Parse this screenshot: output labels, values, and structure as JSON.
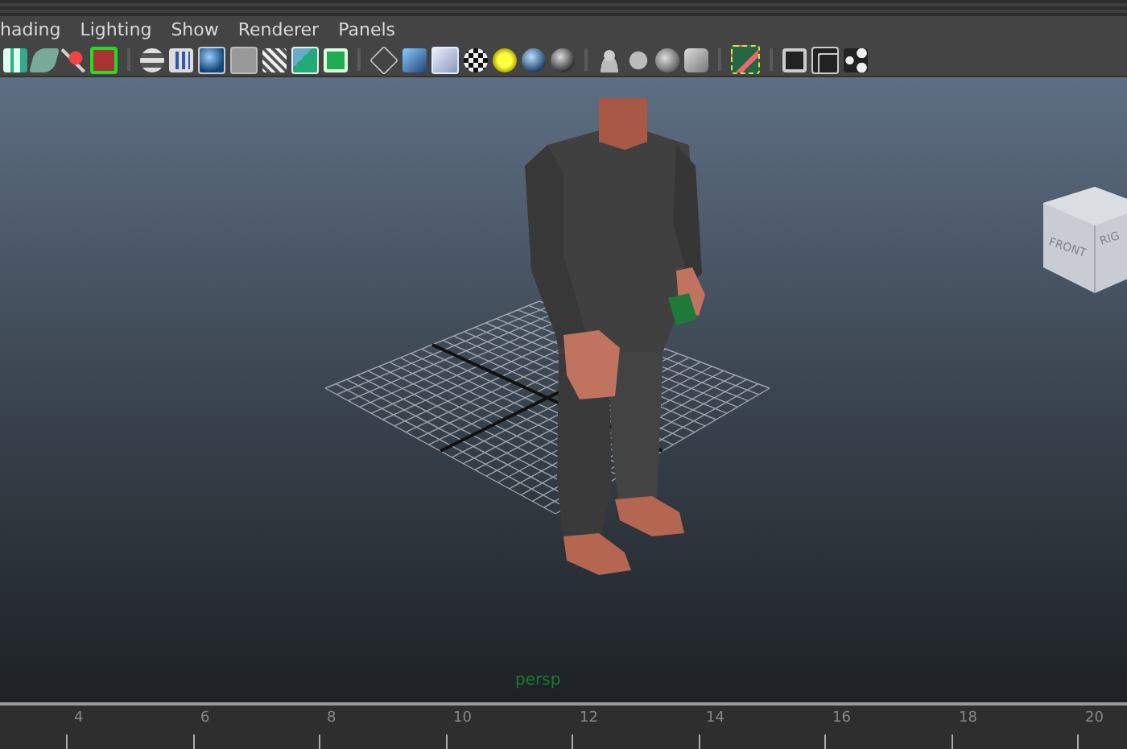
{
  "menu_bar": {
    "items": [
      "hading",
      "Lighting",
      "Show",
      "Renderer",
      "Panels"
    ]
  },
  "viewport": {
    "camera_label": "persp",
    "view_cube": {
      "front": "FRONT",
      "right": "RIG"
    }
  },
  "timeline": {
    "ticks": [
      "4",
      "6",
      "8",
      "10",
      "12",
      "14",
      "16",
      "18",
      "20"
    ]
  }
}
